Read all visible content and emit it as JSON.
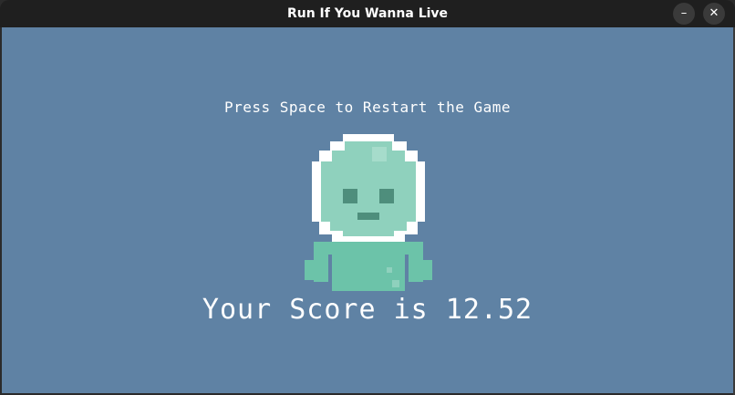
{
  "window": {
    "title": "Run If You Wanna Live",
    "minimize_icon": "minimize-icon",
    "close_icon": "close-icon"
  },
  "game": {
    "restart_prompt": "Press Space to Restart the Game",
    "score_text": "Your Score is 12.52",
    "character": "astronaut-alien-sprite",
    "colors": {
      "background": "#5f82a4",
      "helmet": "#ffffff",
      "face": "#8fd1bd",
      "body": "#6cc3a9",
      "eyes": "#4e8e7c"
    }
  }
}
